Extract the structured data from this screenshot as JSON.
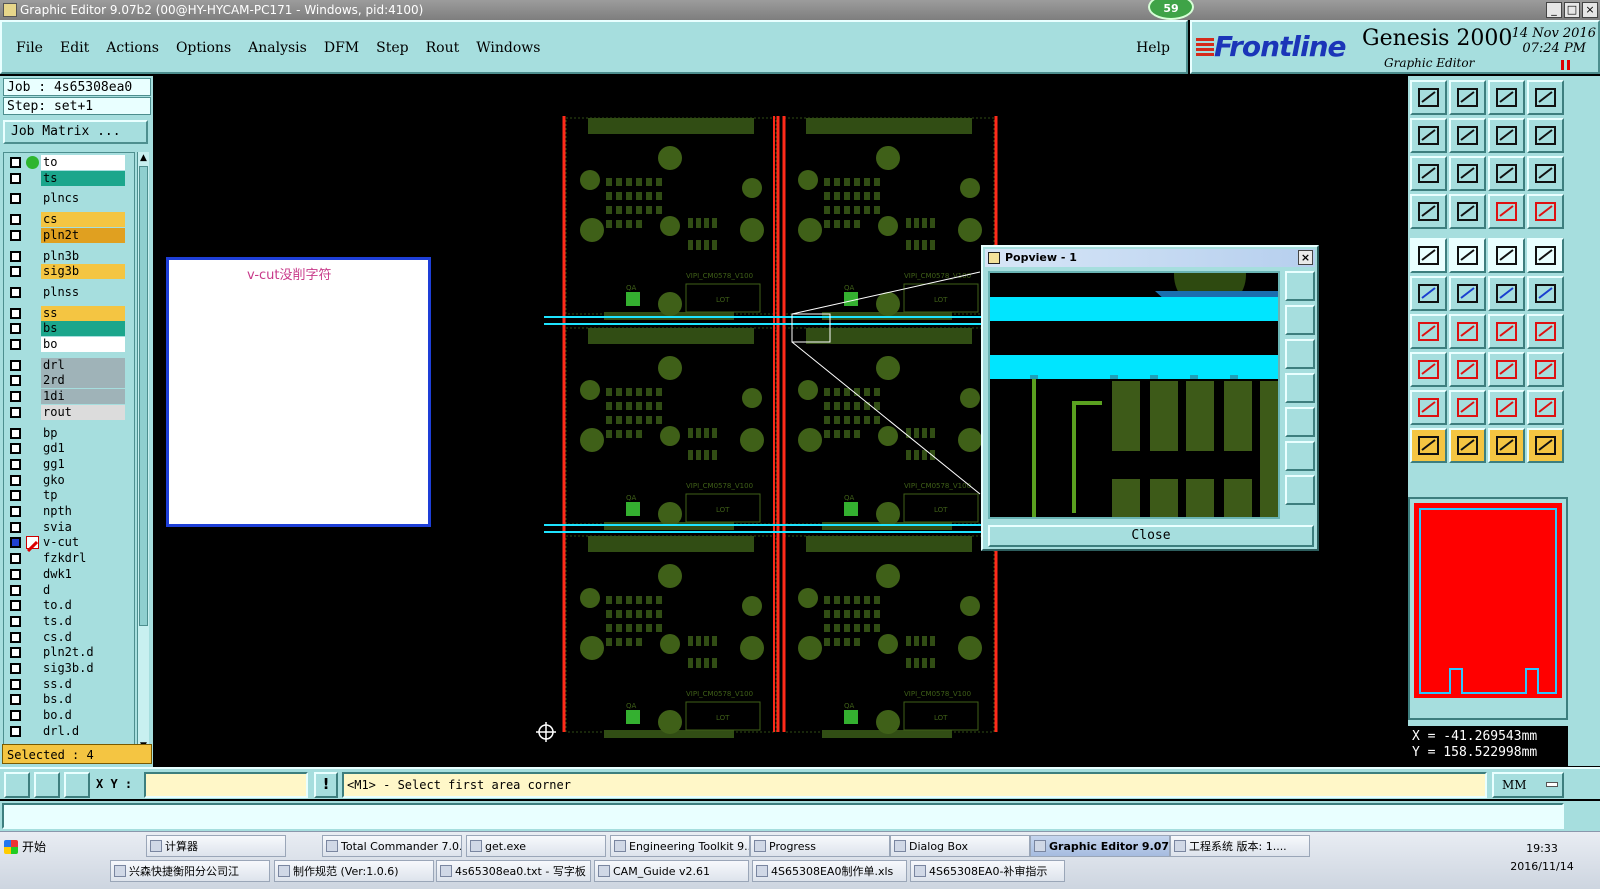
{
  "window": {
    "title": "Graphic Editor 9.07b2 (00@HY-HYCAM-PC171 - Windows, pid:4100)",
    "badge": "59",
    "buttons": [
      "_",
      "□",
      "×"
    ]
  },
  "menu": {
    "items": [
      "File",
      "Edit",
      "Actions",
      "Options",
      "Analysis",
      "DFM",
      "Step",
      "Rout",
      "Windows"
    ],
    "help": "Help"
  },
  "brand": {
    "logo": "Frontline",
    "product": "Genesis 2000",
    "subtitle": "Graphic Editor",
    "date": "14 Nov 2016",
    "time": "07:24 PM"
  },
  "left": {
    "job": "Job : 4s65308ea0",
    "step": "Step: set+1",
    "job_matrix": "Job Matrix ...",
    "selected": "Selected : 4",
    "layers": [
      {
        "name": "to",
        "bg": "#ffffff",
        "mark": "green-dot"
      },
      {
        "name": "ts",
        "bg": "#1ba68c",
        "mark": ""
      },
      {
        "name": "plncs",
        "bg": "#a6dede",
        "mark": ""
      },
      {
        "name": "cs",
        "bg": "#f4c542",
        "mark": ""
      },
      {
        "name": "pln2t",
        "bg": "#e0a020",
        "mark": ""
      },
      {
        "name": "pln3b",
        "bg": "#a6dede",
        "mark": ""
      },
      {
        "name": "sig3b",
        "bg": "#f4c542",
        "mark": ""
      },
      {
        "name": "plnss",
        "bg": "#a6dede",
        "mark": ""
      },
      {
        "name": "ss",
        "bg": "#f4c542",
        "mark": ""
      },
      {
        "name": "bs",
        "bg": "#1ba68c",
        "mark": ""
      },
      {
        "name": "bo",
        "bg": "#ffffff",
        "mark": ""
      },
      {
        "name": "drl",
        "bg": "#9fb3b8",
        "mark": ""
      },
      {
        "name": "2rd",
        "bg": "#9fb3b8",
        "mark": ""
      },
      {
        "name": "1di",
        "bg": "#9fb3b8",
        "mark": ""
      },
      {
        "name": "rout",
        "bg": "#dcdcdc",
        "mark": ""
      },
      {
        "name": "bp",
        "bg": "#a6dede",
        "mark": ""
      },
      {
        "name": "gd1",
        "bg": "#a6dede",
        "mark": ""
      },
      {
        "name": "gg1",
        "bg": "#a6dede",
        "mark": ""
      },
      {
        "name": "gko",
        "bg": "#a6dede",
        "mark": ""
      },
      {
        "name": "tp",
        "bg": "#a6dede",
        "mark": ""
      },
      {
        "name": "npth",
        "bg": "#a6dede",
        "mark": ""
      },
      {
        "name": "svia",
        "bg": "#a6dede",
        "mark": ""
      },
      {
        "name": "v-cut",
        "bg": "#a6dede",
        "mark": "edit-pen"
      },
      {
        "name": "fzkdrl",
        "bg": "#a6dede",
        "mark": ""
      },
      {
        "name": "dwk1",
        "bg": "#a6dede",
        "mark": ""
      },
      {
        "name": "d",
        "bg": "#a6dede",
        "mark": ""
      },
      {
        "name": "to.d",
        "bg": "#a6dede",
        "mark": ""
      },
      {
        "name": "ts.d",
        "bg": "#a6dede",
        "mark": ""
      },
      {
        "name": "cs.d",
        "bg": "#a6dede",
        "mark": ""
      },
      {
        "name": "pln2t.d",
        "bg": "#a6dede",
        "mark": ""
      },
      {
        "name": "sig3b.d",
        "bg": "#a6dede",
        "mark": ""
      },
      {
        "name": "ss.d",
        "bg": "#a6dede",
        "mark": ""
      },
      {
        "name": "bs.d",
        "bg": "#a6dede",
        "mark": ""
      },
      {
        "name": "bo.d",
        "bg": "#a6dede",
        "mark": ""
      },
      {
        "name": "drl.d",
        "bg": "#a6dede",
        "mark": ""
      }
    ]
  },
  "canvas": {
    "note": "v-cut没削字符",
    "board_label": "VIPI_CM0578_V100",
    "lot_label": "LOT",
    "qa_label": "QA"
  },
  "popview": {
    "title": "Popview - 1",
    "close_label": "Close"
  },
  "coords": {
    "x": "X = -41.269543mm",
    "y": "Y = 158.522998mm"
  },
  "command": {
    "xy_label": "X Y :",
    "xy_value": "",
    "bang": "!",
    "prompt": "<M1> - Select first area corner",
    "units": "MM"
  },
  "taskbar": {
    "start": "开始",
    "tasks_top": [
      "计算器",
      "Total Commander 7.0...",
      "get.exe",
      "Engineering Toolkit 9....",
      "Progress",
      "Dialog Box",
      "Graphic Editor 9.07...",
      "工程系统  版本: 1...."
    ],
    "tasks_bottom": [
      "兴森快捷衡阳分公司江",
      "制作规范 (Ver:1.0.6)",
      "4s65308ea0.txt - 写字板",
      "CAM_Guide v2.61",
      "4S65308EA0制作单.xls",
      "4S65308EA0-补审指示"
    ],
    "clock": "19:33",
    "clock_date": "2016/11/14"
  }
}
